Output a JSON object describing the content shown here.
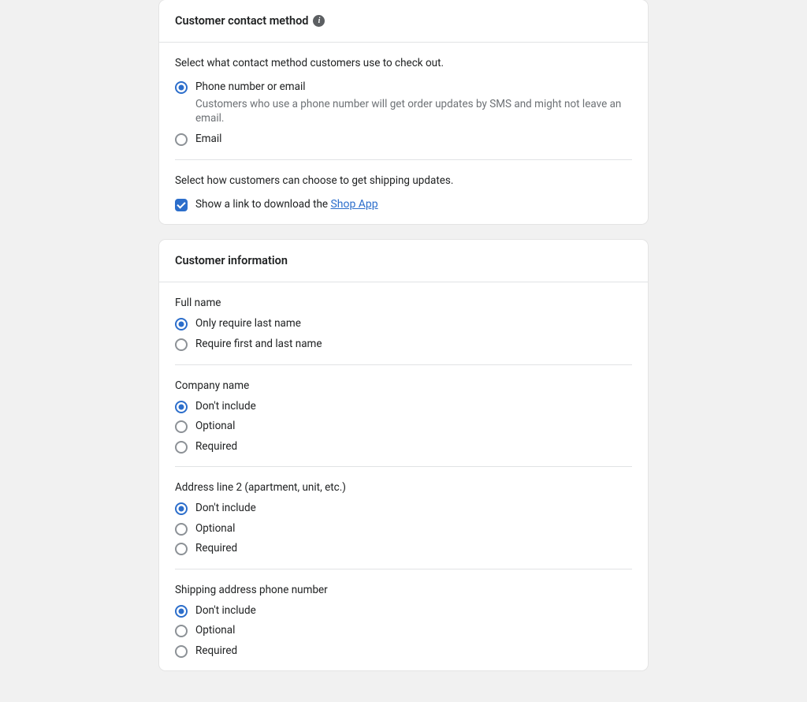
{
  "contactCard": {
    "title": "Customer contact method",
    "section1": {
      "desc": "Select what contact method customers use to check out.",
      "opt1": {
        "label": "Phone number or email",
        "sub": "Customers who use a phone number will get order updates by SMS and might not leave an email."
      },
      "opt2": {
        "label": "Email"
      }
    },
    "section2": {
      "desc": "Select how customers can choose to get shipping updates.",
      "cb1": {
        "prefix": "Show a link to download the ",
        "linkText": "Shop App"
      }
    }
  },
  "infoCard": {
    "title": "Customer information",
    "fullName": {
      "label": "Full name",
      "opt1": "Only require last name",
      "opt2": "Require first and last name"
    },
    "company": {
      "label": "Company name",
      "opt1": "Don't include",
      "opt2": "Optional",
      "opt3": "Required"
    },
    "address2": {
      "label": "Address line 2 (apartment, unit, etc.)",
      "opt1": "Don't include",
      "opt2": "Optional",
      "opt3": "Required"
    },
    "shipPhone": {
      "label": "Shipping address phone number",
      "opt1": "Don't include",
      "opt2": "Optional",
      "opt3": "Required"
    }
  }
}
